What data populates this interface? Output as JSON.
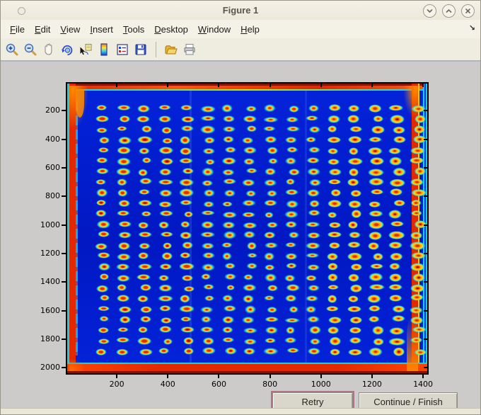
{
  "window": {
    "title": "Figure 1",
    "controls": [
      {
        "name": "shade-button"
      },
      {
        "name": "maximize-button"
      },
      {
        "name": "close-button"
      }
    ]
  },
  "menu_bar": {
    "items": [
      {
        "key": "F",
        "rest": "ile"
      },
      {
        "key": "E",
        "rest": "dit"
      },
      {
        "key": "V",
        "rest": "iew"
      },
      {
        "key": "I",
        "rest": "nsert"
      },
      {
        "key": "T",
        "rest": "ools"
      },
      {
        "key": "D",
        "rest": "esktop"
      },
      {
        "key": "W",
        "rest": "indow"
      },
      {
        "key": "H",
        "rest": "elp"
      }
    ],
    "dock_glyph": "↘"
  },
  "toolbar": {
    "icons": [
      "zoom-in",
      "zoom-out",
      "pan",
      "rotate-3d",
      "data-cursor",
      "insert-colorbar",
      "insert-legend",
      "save-figure",
      "open-file",
      "print-figure"
    ]
  },
  "buttons": {
    "retry": "Retry",
    "continue": "Continue / Finish"
  },
  "chart_data": {
    "type": "heatmap",
    "title": "",
    "description": "Jet-colormap intensity image of a scanned 384-spot plate: 16 columns by 24 rows of red/yellow spots with cyan halos on a deep blue background, saturated red bands along all four image edges with orange corner blobs",
    "x_ticks": [
      200,
      400,
      600,
      800,
      1000,
      1200,
      1400
    ],
    "y_ticks": [
      200,
      400,
      600,
      800,
      1000,
      1200,
      1400,
      1600,
      1800,
      2000
    ],
    "x_range": [
      0,
      1422
    ],
    "y_range": [
      0,
      2048
    ],
    "grid": false,
    "legend": false,
    "colormap": "jet",
    "plate": {
      "rows": 24,
      "cols": 16,
      "col_start": 139,
      "col_step": 82.4,
      "row_start": 174,
      "row_step": 74.0,
      "spot_w": 20,
      "spot_h": 11
    },
    "colors": {
      "background": "#0423da",
      "background_deep": "#0118c2",
      "border_red": "#e32800",
      "corner_orange": "#ff8a00",
      "ring_cyan": "#38dcd4",
      "spot_yellow": "#ffd81e",
      "spot_orange": "#ff9400",
      "spot_red": "#e03000",
      "spot_darkred": "#9e0b00",
      "edge_cyan": "#18cfe8",
      "edge_maroon": "#8a1200"
    }
  }
}
